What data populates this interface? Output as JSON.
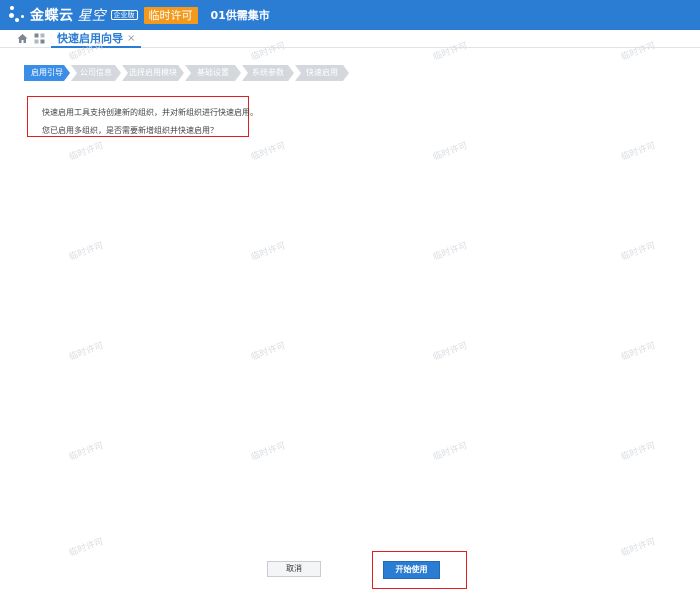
{
  "app": {
    "brand_name": "金蝶云",
    "brand_sub": "星空",
    "edition_badge": "企业版",
    "license_badge": "临时许可",
    "org_name": "01供需集市"
  },
  "tabs": [
    {
      "label": "快速启用向导",
      "close": "×"
    }
  ],
  "steps": [
    "启用引导",
    "公司信息",
    "选择启用模块",
    "基础设置",
    "系统参数",
    "快速启用"
  ],
  "intro": {
    "line1": "快速启用工具支持创建新的组织，并对新组织进行快速启用。",
    "line2": "您已启用多组织，是否需要新增组织并快速启用？"
  },
  "watermark_text": "临时许可",
  "buttons": {
    "cancel": "取消",
    "start": "开始使用"
  },
  "colors": {
    "topbar": "#2b7cd3",
    "license_badge": "#f39a1d",
    "active_step": "#3b8ee8",
    "inactive_step": "#d4d7db",
    "highlight_border": "#e02020"
  }
}
